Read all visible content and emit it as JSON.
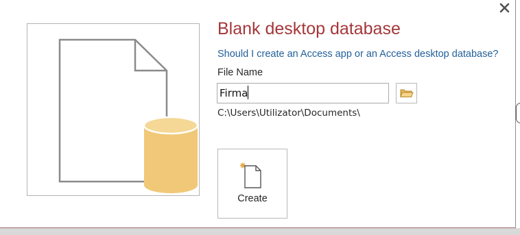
{
  "dialog": {
    "title": "Blank desktop database",
    "question_link": "Should I create an Access app or an Access desktop database?",
    "file_name_label": "File Name",
    "file_name_value": "Firma",
    "file_path": "C:\\Users\\Utilizator\\Documents\\",
    "create_label": "Create"
  },
  "icons": {
    "close": "close-icon",
    "browse": "folder-open-icon",
    "create": "new-file-icon",
    "preview": "blank-database-icon"
  },
  "colors": {
    "title": "#a4373a",
    "link": "#215f9a",
    "database": "#f0c878",
    "text": "#262626"
  }
}
